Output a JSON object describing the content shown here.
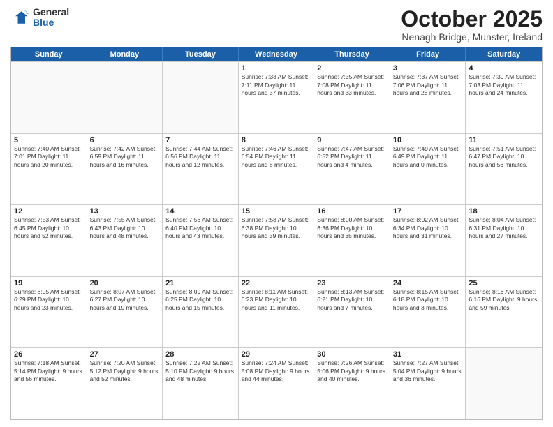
{
  "logo": {
    "general": "General",
    "blue": "Blue"
  },
  "title": "October 2025",
  "subtitle": "Nenagh Bridge, Munster, Ireland",
  "days": [
    "Sunday",
    "Monday",
    "Tuesday",
    "Wednesday",
    "Thursday",
    "Friday",
    "Saturday"
  ],
  "weeks": [
    [
      {
        "day": "",
        "info": ""
      },
      {
        "day": "",
        "info": ""
      },
      {
        "day": "",
        "info": ""
      },
      {
        "day": "1",
        "info": "Sunrise: 7:33 AM\nSunset: 7:11 PM\nDaylight: 11 hours\nand 37 minutes."
      },
      {
        "day": "2",
        "info": "Sunrise: 7:35 AM\nSunset: 7:08 PM\nDaylight: 11 hours\nand 33 minutes."
      },
      {
        "day": "3",
        "info": "Sunrise: 7:37 AM\nSunset: 7:06 PM\nDaylight: 11 hours\nand 28 minutes."
      },
      {
        "day": "4",
        "info": "Sunrise: 7:39 AM\nSunset: 7:03 PM\nDaylight: 11 hours\nand 24 minutes."
      }
    ],
    [
      {
        "day": "5",
        "info": "Sunrise: 7:40 AM\nSunset: 7:01 PM\nDaylight: 11 hours\nand 20 minutes."
      },
      {
        "day": "6",
        "info": "Sunrise: 7:42 AM\nSunset: 6:59 PM\nDaylight: 11 hours\nand 16 minutes."
      },
      {
        "day": "7",
        "info": "Sunrise: 7:44 AM\nSunset: 6:56 PM\nDaylight: 11 hours\nand 12 minutes."
      },
      {
        "day": "8",
        "info": "Sunrise: 7:46 AM\nSunset: 6:54 PM\nDaylight: 11 hours\nand 8 minutes."
      },
      {
        "day": "9",
        "info": "Sunrise: 7:47 AM\nSunset: 6:52 PM\nDaylight: 11 hours\nand 4 minutes."
      },
      {
        "day": "10",
        "info": "Sunrise: 7:49 AM\nSunset: 6:49 PM\nDaylight: 11 hours\nand 0 minutes."
      },
      {
        "day": "11",
        "info": "Sunrise: 7:51 AM\nSunset: 6:47 PM\nDaylight: 10 hours\nand 56 minutes."
      }
    ],
    [
      {
        "day": "12",
        "info": "Sunrise: 7:53 AM\nSunset: 6:45 PM\nDaylight: 10 hours\nand 52 minutes."
      },
      {
        "day": "13",
        "info": "Sunrise: 7:55 AM\nSunset: 6:43 PM\nDaylight: 10 hours\nand 48 minutes."
      },
      {
        "day": "14",
        "info": "Sunrise: 7:56 AM\nSunset: 6:40 PM\nDaylight: 10 hours\nand 43 minutes."
      },
      {
        "day": "15",
        "info": "Sunrise: 7:58 AM\nSunset: 6:38 PM\nDaylight: 10 hours\nand 39 minutes."
      },
      {
        "day": "16",
        "info": "Sunrise: 8:00 AM\nSunset: 6:36 PM\nDaylight: 10 hours\nand 35 minutes."
      },
      {
        "day": "17",
        "info": "Sunrise: 8:02 AM\nSunset: 6:34 PM\nDaylight: 10 hours\nand 31 minutes."
      },
      {
        "day": "18",
        "info": "Sunrise: 8:04 AM\nSunset: 6:31 PM\nDaylight: 10 hours\nand 27 minutes."
      }
    ],
    [
      {
        "day": "19",
        "info": "Sunrise: 8:05 AM\nSunset: 6:29 PM\nDaylight: 10 hours\nand 23 minutes."
      },
      {
        "day": "20",
        "info": "Sunrise: 8:07 AM\nSunset: 6:27 PM\nDaylight: 10 hours\nand 19 minutes."
      },
      {
        "day": "21",
        "info": "Sunrise: 8:09 AM\nSunset: 6:25 PM\nDaylight: 10 hours\nand 15 minutes."
      },
      {
        "day": "22",
        "info": "Sunrise: 8:11 AM\nSunset: 6:23 PM\nDaylight: 10 hours\nand 11 minutes."
      },
      {
        "day": "23",
        "info": "Sunrise: 8:13 AM\nSunset: 6:21 PM\nDaylight: 10 hours\nand 7 minutes."
      },
      {
        "day": "24",
        "info": "Sunrise: 8:15 AM\nSunset: 6:18 PM\nDaylight: 10 hours\nand 3 minutes."
      },
      {
        "day": "25",
        "info": "Sunrise: 8:16 AM\nSunset: 6:16 PM\nDaylight: 9 hours\nand 59 minutes."
      }
    ],
    [
      {
        "day": "26",
        "info": "Sunrise: 7:18 AM\nSunset: 5:14 PM\nDaylight: 9 hours\nand 56 minutes."
      },
      {
        "day": "27",
        "info": "Sunrise: 7:20 AM\nSunset: 5:12 PM\nDaylight: 9 hours\nand 52 minutes."
      },
      {
        "day": "28",
        "info": "Sunrise: 7:22 AM\nSunset: 5:10 PM\nDaylight: 9 hours\nand 48 minutes."
      },
      {
        "day": "29",
        "info": "Sunrise: 7:24 AM\nSunset: 5:08 PM\nDaylight: 9 hours\nand 44 minutes."
      },
      {
        "day": "30",
        "info": "Sunrise: 7:26 AM\nSunset: 5:06 PM\nDaylight: 9 hours\nand 40 minutes."
      },
      {
        "day": "31",
        "info": "Sunrise: 7:27 AM\nSunset: 5:04 PM\nDaylight: 9 hours\nand 36 minutes."
      },
      {
        "day": "",
        "info": ""
      }
    ]
  ]
}
